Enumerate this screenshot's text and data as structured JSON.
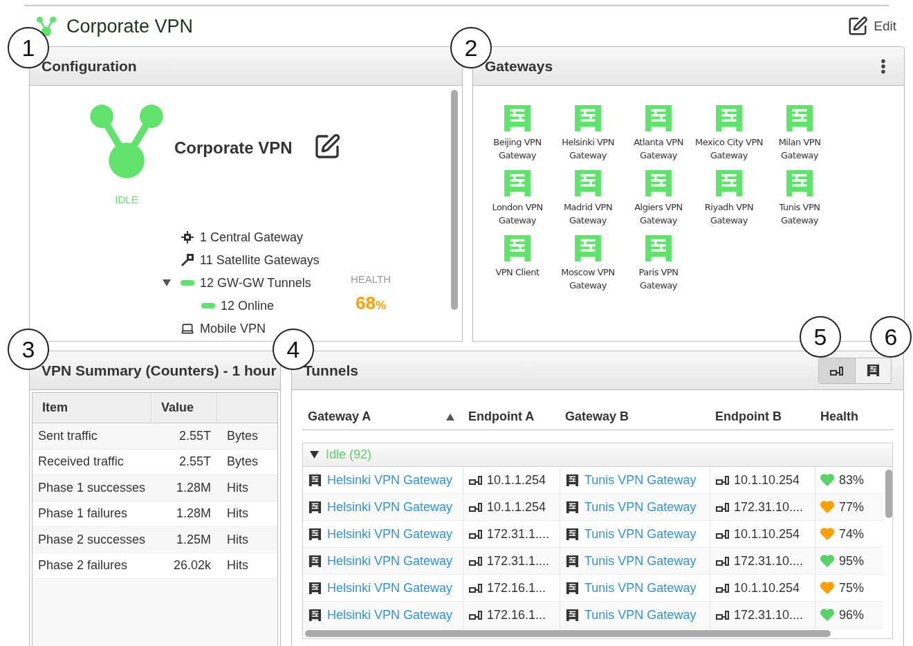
{
  "page": {
    "title": "Corporate VPN",
    "edit_label": "Edit"
  },
  "configuration": {
    "title": "Configuration",
    "vpn_name": "Corporate VPN",
    "status": "IDLE",
    "health_label": "HEALTH",
    "health_value": "68",
    "health_unit": "%",
    "items": [
      {
        "kind": "central",
        "label": "1 Central Gateway"
      },
      {
        "kind": "satellite",
        "label": "11 Satellite Gateways"
      },
      {
        "kind": "tunnels",
        "label": "12 GW-GW Tunnels",
        "expanded": true,
        "children": [
          {
            "kind": "tunnels",
            "label": "12 Online"
          }
        ]
      },
      {
        "kind": "mobile",
        "label": "Mobile VPN"
      }
    ]
  },
  "gateways": {
    "title": "Gateways",
    "items": [
      "Beijing VPN Gateway",
      "Helsinki VPN Gateway",
      "Atlanta VPN Gateway",
      "Mexico City VPN Gateway",
      "Milan VPN Gateway",
      "London VPN Gateway",
      "Madrid VPN Gateway",
      "Algiers VPN Gateway",
      "Riyadh VPN Gateway",
      "Tunis VPN Gateway",
      "VPN Client",
      "Moscow VPN Gateway",
      "Paris VPN Gateway"
    ]
  },
  "summary": {
    "title": "VPN Summary (Counters) - 1 hour",
    "columns": [
      "Item",
      "Value"
    ],
    "rows": [
      {
        "item": "Sent traffic",
        "value": "2.55T",
        "unit": "Bytes"
      },
      {
        "item": "Received traffic",
        "value": "2.55T",
        "unit": "Bytes"
      },
      {
        "item": "Phase 1 successes",
        "value": "1.28M",
        "unit": "Hits"
      },
      {
        "item": "Phase 1 failures",
        "value": "1.28M",
        "unit": "Hits"
      },
      {
        "item": "Phase 2 successes",
        "value": "1.25M",
        "unit": "Hits"
      },
      {
        "item": "Phase 2 failures",
        "value": "26.02k",
        "unit": "Hits"
      }
    ]
  },
  "tunnels": {
    "title": "Tunnels",
    "view_buttons": [
      {
        "kind": "endpoint",
        "selected": true
      },
      {
        "kind": "gateway",
        "selected": false
      }
    ],
    "columns": [
      "Gateway A",
      "Endpoint A",
      "Gateway B",
      "Endpoint B",
      "Health"
    ],
    "group": {
      "label": "Idle (92)",
      "expanded": true
    },
    "rows": [
      {
        "gateway_a": "Helsinki VPN Gateway",
        "endpoint_a": "10.1.1.254",
        "gateway_b": "Tunis VPN Gateway",
        "endpoint_b": "10.1.10.254",
        "health": "83%",
        "color": "#5bd16a"
      },
      {
        "gateway_a": "Helsinki VPN Gateway",
        "endpoint_a": "10.1.1.254",
        "gateway_b": "Tunis VPN Gateway",
        "endpoint_b": "172.31.10....",
        "health": "77%",
        "color": "#ff9f00"
      },
      {
        "gateway_a": "Helsinki VPN Gateway",
        "endpoint_a": "172.31.1....",
        "gateway_b": "Tunis VPN Gateway",
        "endpoint_b": "10.1.10.254",
        "health": "74%",
        "color": "#ff9f00"
      },
      {
        "gateway_a": "Helsinki VPN Gateway",
        "endpoint_a": "172.31.1....",
        "gateway_b": "Tunis VPN Gateway",
        "endpoint_b": "172.31.10....",
        "health": "95%",
        "color": "#5bd16a"
      },
      {
        "gateway_a": "Helsinki VPN Gateway",
        "endpoint_a": "172.16.1...",
        "gateway_b": "Tunis VPN Gateway",
        "endpoint_b": "10.1.10.254",
        "health": "75%",
        "color": "#ff9f00"
      },
      {
        "gateway_a": "Helsinki VPN Gateway",
        "endpoint_a": "172.16.1...",
        "gateway_b": "Tunis VPN Gateway",
        "endpoint_b": "172.31.10....",
        "health": "96%",
        "color": "#5bd16a"
      }
    ]
  },
  "callouts": [
    "1",
    "2",
    "3",
    "4",
    "5",
    "6"
  ]
}
